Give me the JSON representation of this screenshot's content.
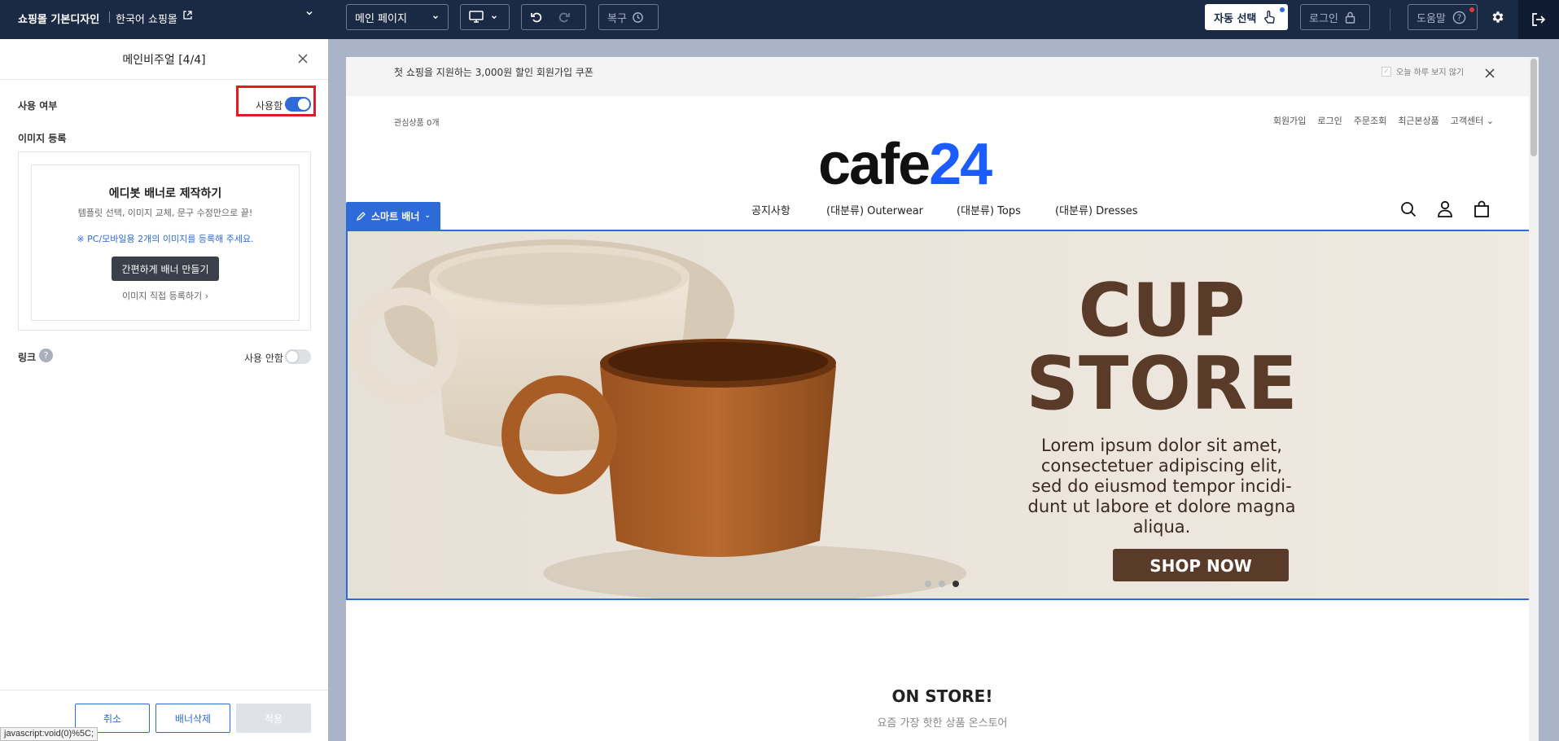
{
  "topbar": {
    "brand": "쇼핑몰 기본디자인",
    "shop": "한국어 쇼핑몰",
    "page_select": "메인 페이지",
    "restore": "복구",
    "auto_select": "자동 선택",
    "login": "로그인",
    "help": "도움말",
    "colors": {
      "bg": "#1b2a44",
      "accent": "#2f6bd8",
      "alert": "#e53935"
    }
  },
  "panel": {
    "title": "메인비주얼 [4/4]",
    "use_label": "사용 여부",
    "use_state": "사용함",
    "image_label": "이미지 등록",
    "box_title": "에디봇 배너로 제작하기",
    "box_desc": "템플릿 선택, 이미지 교체, 문구 수정만으로 끝!",
    "box_note": "※ PC/모바일용 2개의 이미지를 등록해 주세요.",
    "make_button": "간편하게 배너 만들기",
    "direct_link": "이미지 직접 등록하기 ›",
    "link_label": "링크",
    "link_state": "사용 안함",
    "footer": {
      "cancel": "취소",
      "delete": "배너삭제",
      "apply": "적용"
    }
  },
  "status_bar": "javascript:void(0)%5C;",
  "preview": {
    "promo_text": "첫 쇼핑을 지원하는 3,000원 할인 회원가입 쿠폰",
    "promo_hide": "오늘 하루 보지 않기",
    "wish": "관심상품 0개",
    "header_links": [
      "회원가입",
      "로그인",
      "주문조회",
      "최근본상품",
      "고객센터"
    ],
    "logo_black": "cafe",
    "logo_blue": "24",
    "nav": [
      "공지사항",
      "(대분류) Outerwear",
      "(대분류) Tops",
      "(대분류) Dresses"
    ],
    "smart_banner": "스마트 배너",
    "banner": {
      "title1": "CUP",
      "title2": "STORE",
      "body": [
        "Lorem ipsum dolor sit amet,",
        "consectetuer adipiscing elit,",
        "sed do eiusmod tempor incidi-",
        "dunt ut labore et dolore magna",
        "aliqua."
      ],
      "cta": "SHOP NOW"
    },
    "section_title": "ON STORE!",
    "section_sub": "요즘 가장 핫한 상품 온스토어"
  }
}
